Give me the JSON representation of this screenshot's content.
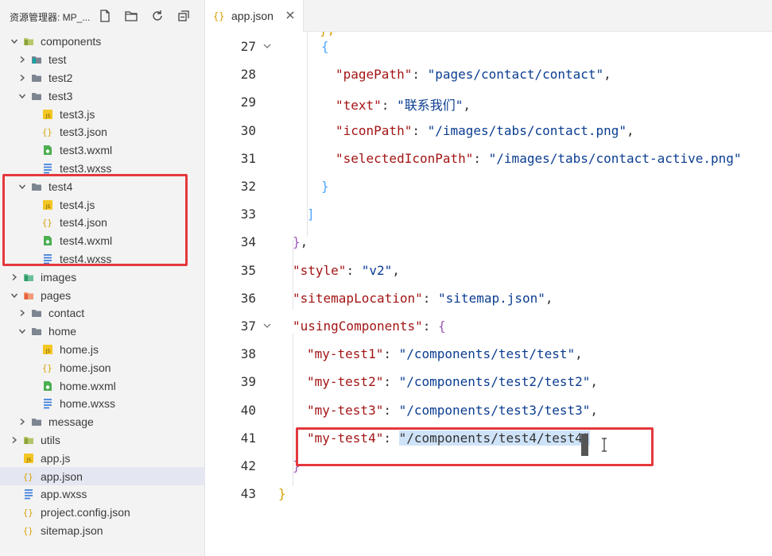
{
  "explorer": {
    "title": "资源管理器: MP_...",
    "actions": [
      {
        "name": "new-file-icon"
      },
      {
        "name": "new-folder-icon"
      },
      {
        "name": "refresh-icon"
      },
      {
        "name": "collapse-all-icon"
      }
    ],
    "tree": [
      {
        "label": "components",
        "depth": 0,
        "kind": "folder-components",
        "expanded": true
      },
      {
        "label": "test",
        "depth": 1,
        "kind": "folder-teal",
        "expanded": false
      },
      {
        "label": "test2",
        "depth": 1,
        "kind": "folder",
        "expanded": false
      },
      {
        "label": "test3",
        "depth": 1,
        "kind": "folder",
        "expanded": true
      },
      {
        "label": "test3.js",
        "depth": 2,
        "kind": "js"
      },
      {
        "label": "test3.json",
        "depth": 2,
        "kind": "json"
      },
      {
        "label": "test3.wxml",
        "depth": 2,
        "kind": "wxml"
      },
      {
        "label": "test3.wxss",
        "depth": 2,
        "kind": "wxss"
      },
      {
        "label": "test4",
        "depth": 1,
        "kind": "folder",
        "expanded": true
      },
      {
        "label": "test4.js",
        "depth": 2,
        "kind": "js"
      },
      {
        "label": "test4.json",
        "depth": 2,
        "kind": "json"
      },
      {
        "label": "test4.wxml",
        "depth": 2,
        "kind": "wxml"
      },
      {
        "label": "test4.wxss",
        "depth": 2,
        "kind": "wxss"
      },
      {
        "label": "images",
        "depth": 0,
        "kind": "folder-images",
        "expanded": false
      },
      {
        "label": "pages",
        "depth": 0,
        "kind": "folder-pages",
        "expanded": true
      },
      {
        "label": "contact",
        "depth": 1,
        "kind": "folder",
        "expanded": false
      },
      {
        "label": "home",
        "depth": 1,
        "kind": "folder",
        "expanded": true
      },
      {
        "label": "home.js",
        "depth": 2,
        "kind": "js"
      },
      {
        "label": "home.json",
        "depth": 2,
        "kind": "json"
      },
      {
        "label": "home.wxml",
        "depth": 2,
        "kind": "wxml"
      },
      {
        "label": "home.wxss",
        "depth": 2,
        "kind": "wxss"
      },
      {
        "label": "message",
        "depth": 1,
        "kind": "folder",
        "expanded": false
      },
      {
        "label": "utils",
        "depth": 0,
        "kind": "folder-utils",
        "expanded": false
      },
      {
        "label": "app.js",
        "depth": 0,
        "kind": "js"
      },
      {
        "label": "app.json",
        "depth": 0,
        "kind": "json",
        "selected": true
      },
      {
        "label": "app.wxss",
        "depth": 0,
        "kind": "wxss"
      },
      {
        "label": "project.config.json",
        "depth": 0,
        "kind": "json"
      },
      {
        "label": "sitemap.json",
        "depth": 0,
        "kind": "json"
      }
    ]
  },
  "editor_tab": {
    "label": "app.json",
    "icon": "json-file-icon",
    "close_icon": "close-icon"
  },
  "code_lines": [
    {
      "num": "27",
      "indent": 2,
      "fold": true,
      "tokens": [
        [
          "{",
          "b3"
        ]
      ]
    },
    {
      "num": "28",
      "indent": 3,
      "tokens": [
        [
          "\"pagePath\"",
          "k"
        ],
        [
          ": ",
          "p"
        ],
        [
          "\"pages/contact/contact\"",
          "s"
        ],
        [
          ",",
          "p"
        ]
      ]
    },
    {
      "num": "29",
      "indent": 3,
      "tokens": [
        [
          "\"text\"",
          "k"
        ],
        [
          ": ",
          "p"
        ],
        [
          "\"联系我们\"",
          "s"
        ],
        [
          ",",
          "p"
        ]
      ]
    },
    {
      "num": "30",
      "indent": 3,
      "tokens": [
        [
          "\"iconPath\"",
          "k"
        ],
        [
          ": ",
          "p"
        ],
        [
          "\"/images/tabs/contact.png\"",
          "s"
        ],
        [
          ",",
          "p"
        ]
      ]
    },
    {
      "num": "31",
      "indent": 3,
      "tokens": [
        [
          "\"selectedIconPath\"",
          "k"
        ],
        [
          ": ",
          "p"
        ],
        [
          "\"/images/tabs/contact-active.png\"",
          "s"
        ]
      ]
    },
    {
      "num": "32",
      "indent": 2,
      "tokens": [
        [
          "}",
          "b3"
        ]
      ]
    },
    {
      "num": "33",
      "indent": 1,
      "tokens": [
        [
          "]",
          "b3"
        ]
      ]
    },
    {
      "num": "34",
      "indent": 0,
      "tokens": [
        [
          "}",
          "b2"
        ],
        [
          ",",
          "p"
        ]
      ]
    },
    {
      "num": "35",
      "indent": 0,
      "tokens": [
        [
          "\"style\"",
          "k"
        ],
        [
          ": ",
          "p"
        ],
        [
          "\"v2\"",
          "s"
        ],
        [
          ",",
          "p"
        ]
      ]
    },
    {
      "num": "36",
      "indent": 0,
      "tokens": [
        [
          "\"sitemapLocation\"",
          "k"
        ],
        [
          ": ",
          "p"
        ],
        [
          "\"sitemap.json\"",
          "s"
        ],
        [
          ",",
          "p"
        ]
      ]
    },
    {
      "num": "37",
      "indent": 0,
      "fold": true,
      "tokens": [
        [
          "\"usingComponents\"",
          "k"
        ],
        [
          ": ",
          "p"
        ],
        [
          "{",
          "b2"
        ]
      ]
    },
    {
      "num": "38",
      "indent": 1,
      "tokens": [
        [
          "\"my-test1\"",
          "k"
        ],
        [
          ": ",
          "p"
        ],
        [
          "\"/components/test/test\"",
          "s"
        ],
        [
          ",",
          "p"
        ]
      ]
    },
    {
      "num": "39",
      "indent": 1,
      "tokens": [
        [
          "\"my-test2\"",
          "k"
        ],
        [
          ": ",
          "p"
        ],
        [
          "\"/components/test2/test2\"",
          "s"
        ],
        [
          ",",
          "p"
        ]
      ]
    },
    {
      "num": "40",
      "indent": 1,
      "tokens": [
        [
          "\"my-test3\"",
          "k"
        ],
        [
          ": ",
          "p"
        ],
        [
          "\"/components/test3/test3\"",
          "s"
        ],
        [
          ",",
          "p"
        ]
      ]
    },
    {
      "num": "41",
      "indent": 1,
      "tokens": [
        [
          "\"my-test4\"",
          "k"
        ],
        [
          ": ",
          "p"
        ],
        [
          "\"/components/test4/test4\"",
          "sel"
        ]
      ]
    },
    {
      "num": "42",
      "indent": 0,
      "tokens": [
        [
          "}",
          "b2"
        ]
      ]
    },
    {
      "num": "43",
      "indent": -1,
      "tokens": [
        [
          "}",
          "b1"
        ]
      ]
    }
  ],
  "colors": {
    "highlight_box": "#e4383c",
    "string": "#0b3d91",
    "key": "#a31515",
    "selection": "#cfe3f8",
    "selected_row": "#e4e6f1"
  }
}
